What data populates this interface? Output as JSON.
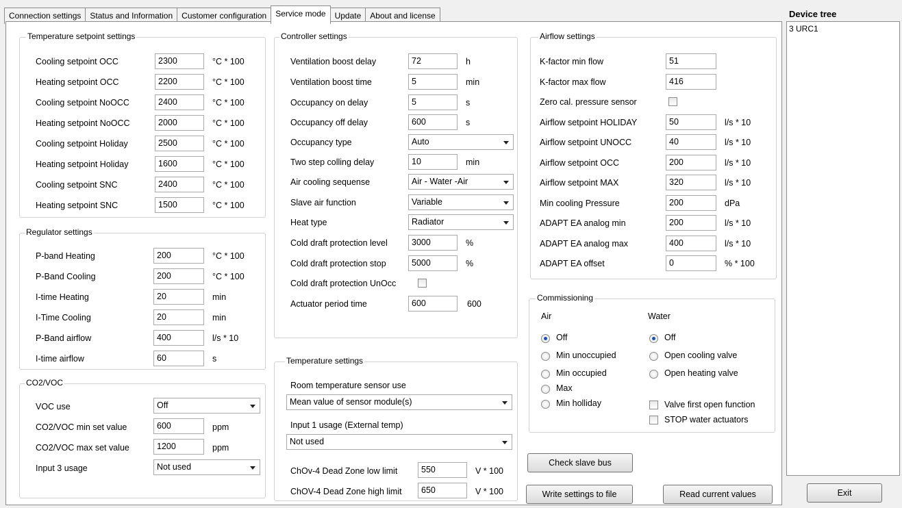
{
  "tabs": [
    "Connection settings",
    "Status and Information",
    "Customer configuration",
    "Service mode",
    "Update",
    "About and license"
  ],
  "temperature_setpoints": {
    "title": "Temperature setpoint settings",
    "rows": [
      {
        "label": "Cooling setpoint OCC",
        "value": "2300",
        "unit": "°C * 100"
      },
      {
        "label": "Heating setpoint OCC",
        "value": "2200",
        "unit": "°C * 100"
      },
      {
        "label": "Cooling setpoint NoOCC",
        "value": "2400",
        "unit": "°C * 100"
      },
      {
        "label": "Heating setpoint NoOCC",
        "value": "2000",
        "unit": "°C * 100"
      },
      {
        "label": "Cooling setpoint Holiday",
        "value": "2500",
        "unit": "°C * 100"
      },
      {
        "label": "Heating setpoint Holiday",
        "value": "1600",
        "unit": "°C * 100"
      },
      {
        "label": "Cooling setpoint SNC",
        "value": "2400",
        "unit": "°C * 100"
      },
      {
        "label": "Heating setpoint SNC",
        "value": "1500",
        "unit": "°C * 100"
      }
    ]
  },
  "regulator": {
    "title": "Regulator settings",
    "rows": [
      {
        "label": "P-band Heating",
        "value": "200",
        "unit": "°C * 100"
      },
      {
        "label": "P-Band Cooling",
        "value": "200",
        "unit": "°C * 100"
      },
      {
        "label": "I-time Heating",
        "value": "20",
        "unit": "min"
      },
      {
        "label": "I-Time Cooling",
        "value": "20",
        "unit": "min"
      },
      {
        "label": "P-Band airflow",
        "value": "400",
        "unit": "l/s * 10"
      },
      {
        "label": "I-time airflow",
        "value": "60",
        "unit": "s"
      }
    ]
  },
  "co2voc": {
    "title": "CO2/VOC",
    "voc_use_label": "VOC use",
    "voc_use_value": "Off",
    "min_label": "CO2/VOC min set value",
    "min_value": "600",
    "min_unit": "ppm",
    "max_label": "CO2/VOC max set value",
    "max_value": "1200",
    "max_unit": "ppm",
    "input3_label": "Input 3 usage",
    "input3_value": "Not used"
  },
  "controller": {
    "title": "Controller settings",
    "rows": [
      {
        "label": "Ventilation boost delay",
        "value": "72",
        "unit": "h"
      },
      {
        "label": "Ventilation boost time",
        "value": "5",
        "unit": "min"
      },
      {
        "label": "Occupancy on delay",
        "value": "5",
        "unit": "s"
      },
      {
        "label": "Occupancy off delay",
        "value": "600",
        "unit": "s"
      },
      {
        "label": "Occupancy type",
        "value": "Auto",
        "unit": ""
      },
      {
        "label": "Two step colling delay",
        "value": "10",
        "unit": "min"
      },
      {
        "label": "Air cooling sequense",
        "value": "Air - Water -Air",
        "unit": ""
      },
      {
        "label": "Slave air function",
        "value": "Variable",
        "unit": ""
      },
      {
        "label": "Heat type",
        "value": "Radiator",
        "unit": ""
      },
      {
        "label": "Cold draft protection level",
        "value": "3000",
        "unit": "%"
      },
      {
        "label": "Cold draft protection stop",
        "value": "5000",
        "unit": "%"
      },
      {
        "label": "Cold draft protection UnOcc",
        "value": "",
        "unit": ""
      },
      {
        "label": "Actuator period time",
        "value": "600",
        "unit": "600"
      }
    ]
  },
  "temperature_settings": {
    "title": "Temperature settings",
    "room_sensor_label": "Room temperature sensor use",
    "room_sensor_value": "Mean value of sensor module(s)",
    "input1_label": "Input 1 usage (External temp)",
    "input1_value": "Not used",
    "low_label": "ChOv-4 Dead Zone low limit",
    "low_value": "550",
    "low_unit": "V * 100",
    "high_label": "ChOV-4 Dead Zone high limit",
    "high_value": "650",
    "high_unit": "V * 100"
  },
  "airflow": {
    "title": "Airflow settings",
    "rows": [
      {
        "label": "K-factor min flow",
        "value": "51",
        "unit": ""
      },
      {
        "label": "K-factor max flow",
        "value": "416",
        "unit": ""
      },
      {
        "label": "Zero cal. pressure sensor",
        "value": "",
        "unit": ""
      },
      {
        "label": "Airflow setpoint HOLIDAY",
        "value": "50",
        "unit": "l/s * 10"
      },
      {
        "label": "Airflow setpoint UNOCC",
        "value": "40",
        "unit": "l/s * 10"
      },
      {
        "label": "Airflow setpoint OCC",
        "value": "200",
        "unit": "l/s * 10"
      },
      {
        "label": "Airflow setpoint MAX",
        "value": "320",
        "unit": "l/s * 10"
      },
      {
        "label": "Min cooling Pressure",
        "value": "200",
        "unit": "dPa"
      },
      {
        "label": "ADAPT EA analog min",
        "value": "200",
        "unit": "l/s * 10"
      },
      {
        "label": "ADAPT EA analog max",
        "value": "400",
        "unit": "l/s * 10"
      },
      {
        "label": "ADAPT EA offset",
        "value": "0",
        "unit": "% * 100"
      }
    ]
  },
  "commissioning": {
    "title": "Commissioning",
    "air_label": "Air",
    "water_label": "Water",
    "air_options": [
      "Off",
      "Min unoccupied",
      "Min occupied",
      "Max",
      "Min holliday"
    ],
    "water_options": [
      "Off",
      "Open cooling valve",
      "Open heating valve"
    ],
    "valve_first_label": "Valve first open function",
    "stop_water_label": "STOP water actuators"
  },
  "buttons": {
    "check_slave": "Check slave bus",
    "write_settings": "Write settings to file",
    "read_current": "Read current values",
    "exit": "Exit"
  },
  "device_tree": {
    "title": "Device tree",
    "items": [
      "3 URC1"
    ]
  },
  "colors": {
    "radio_dot": "#1c4fb3",
    "border": "#8c8c8c"
  }
}
